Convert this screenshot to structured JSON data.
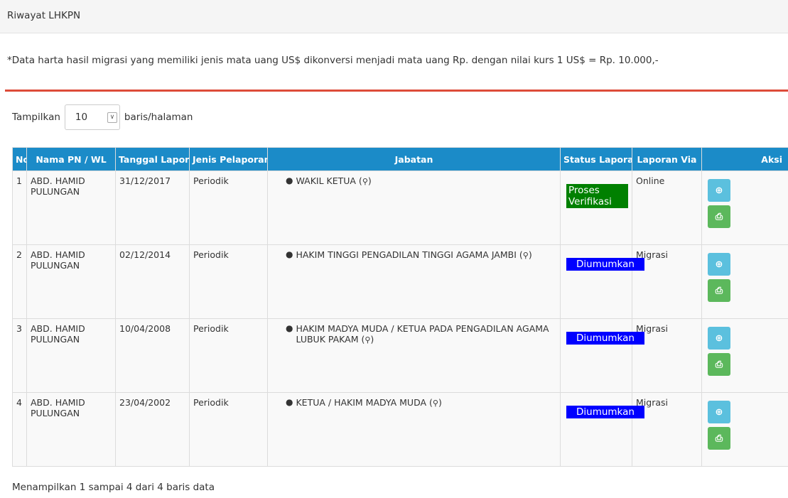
{
  "header": {
    "title": "Riwayat LHKPN"
  },
  "notice": "*Data harta hasil migrasi yang memiliki jenis mata uang US$ dikonversi menjadi mata uang Rp. dengan nilai kurs 1 US$ = Rp. 10.000,-",
  "colors": {
    "header_blue": "#1b8bc8",
    "divider_red": "#dd4b39",
    "status_green": "#008000",
    "status_blue": "#0000ff",
    "btn_view": "#5bc0de",
    "btn_print": "#5cb85c"
  },
  "length_control": {
    "prefix": "Tampilkan",
    "value": "10",
    "suffix": "baris/halaman"
  },
  "table": {
    "columns": [
      "No.",
      "Nama PN / WL",
      "Tanggal Lapor",
      "Jenis Pelaporan",
      "Jabatan",
      "Status Laporan",
      "Laporan Via",
      "Aksi"
    ],
    "rows": [
      {
        "no": "1",
        "nama": "ABD. HAMID PULUNGAN",
        "tanggal": "31/12/2017",
        "jenis": "Periodik",
        "jabatan": "WAKIL KETUA (",
        "status": "Proses Verifikasi",
        "via": "Online"
      },
      {
        "no": "2",
        "nama": "ABD. HAMID PULUNGAN",
        "tanggal": "02/12/2014",
        "jenis": "Periodik",
        "jabatan": "HAKIM TINGGI PENGADILAN TINGGI AGAMA JAMBI (",
        "status": "Diumumkan",
        "via": "Migrasi"
      },
      {
        "no": "3",
        "nama": "ABD. HAMID PULUNGAN",
        "tanggal": "10/04/2008",
        "jenis": "Periodik",
        "jabatan": "HAKIM MADYA MUDA / KETUA PADA PENGADILAN AGAMA LUBUK PAKAM (",
        "status": "Diumumkan",
        "via": "Migrasi"
      },
      {
        "no": "4",
        "nama": "ABD. HAMID PULUNGAN",
        "tanggal": "23/04/2002",
        "jenis": "Periodik",
        "jabatan": "KETUA / HAKIM MADYA MUDA (",
        "status": "Diumumkan",
        "via": "Migrasi"
      }
    ]
  },
  "info": "Menampilkan 1 sampai 4 dari 4 baris data",
  "icons": {
    "key": "key-icon",
    "view": "zoom-in-icon",
    "print": "print-icon"
  }
}
